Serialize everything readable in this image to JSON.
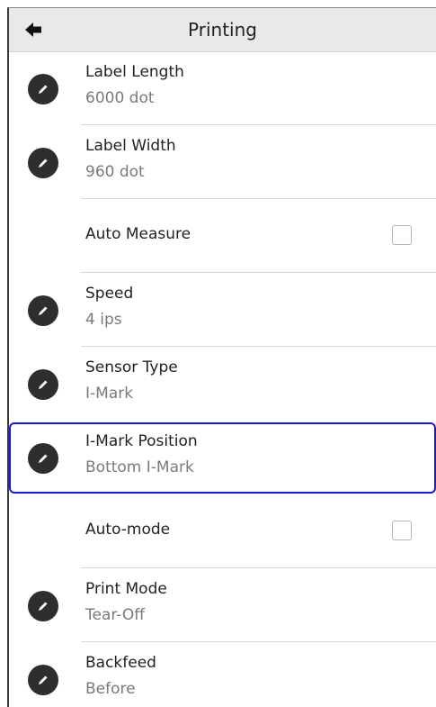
{
  "header": {
    "title": "Printing",
    "back_icon": "arrow-left-icon"
  },
  "rows": [
    {
      "label": "Label Length",
      "value": "6000 dot",
      "icon": "pencil-icon"
    },
    {
      "label": "Label Width",
      "value": "960 dot",
      "icon": "pencil-icon"
    },
    {
      "label": "Auto Measure",
      "checked": false
    },
    {
      "label": "Speed",
      "value": "4 ips",
      "icon": "pencil-icon"
    },
    {
      "label": "Sensor Type",
      "value": "I-Mark",
      "icon": "pencil-icon"
    },
    {
      "label": "I-Mark Position",
      "value": "Bottom I-Mark",
      "icon": "pencil-icon",
      "selected": true
    },
    {
      "label": "Auto-mode",
      "checked": false
    },
    {
      "label": "Print Mode",
      "value": "Tear-Off",
      "icon": "pencil-icon"
    },
    {
      "label": "Backfeed",
      "value": "Before",
      "icon": "pencil-icon"
    }
  ],
  "colors": {
    "header_bg": "#e9e9e9",
    "selection_border": "#1a1ad6",
    "icon_bg": "#2e2e2e",
    "value_text": "#7a7a7a"
  }
}
